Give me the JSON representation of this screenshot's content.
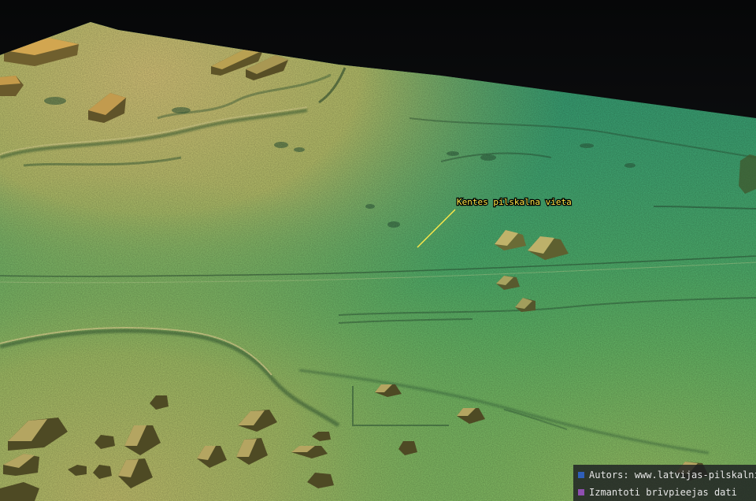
{
  "scene": {
    "annotation": {
      "label": "Kentes pilskalna vieta",
      "color": "#ffe94a"
    },
    "terrain_colors": {
      "lowland": "#3ea57a",
      "plain": "#57b668",
      "upland": "#a7c168",
      "highland": "#d2c57c",
      "buildings": "#6c6030"
    }
  },
  "attribution": {
    "items": [
      {
        "text": "Autors: www.latvijas-pilskalni.lv",
        "color": "#2f5fb8"
      },
      {
        "text": "Izmantoti brīvpieejas dati",
        "color": "#8e4fb0"
      }
    ]
  }
}
